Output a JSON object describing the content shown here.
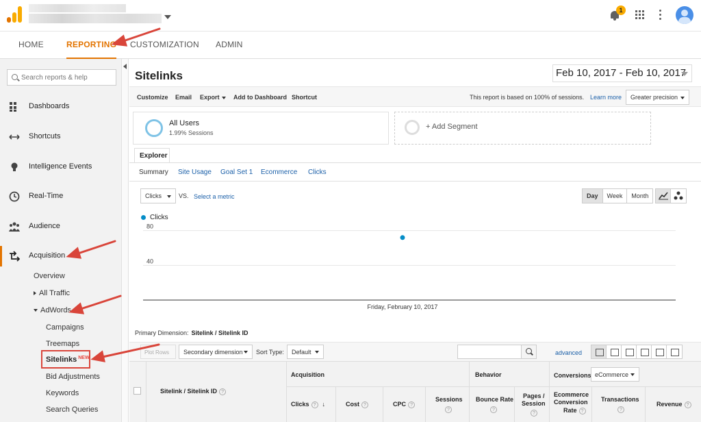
{
  "topbar": {
    "notifications_count": "1"
  },
  "nav": {
    "tabs": [
      "HOME",
      "REPORTING",
      "CUSTOMIZATION",
      "ADMIN"
    ],
    "active": "REPORTING"
  },
  "sidebar": {
    "search_placeholder": "Search reports & help",
    "items": [
      {
        "label": "Dashboards",
        "icon": "grid-icon"
      },
      {
        "label": "Shortcuts",
        "icon": "shortcut-arrows-icon"
      },
      {
        "label": "Intelligence Events",
        "icon": "lightbulb-icon"
      },
      {
        "label": "Real-Time",
        "icon": "clock-icon"
      },
      {
        "label": "Audience",
        "icon": "people-icon"
      },
      {
        "label": "Acquisition",
        "icon": "acquisition-arrows-icon"
      }
    ],
    "acquisition_children": {
      "overview": "Overview",
      "all_traffic": "All Traffic",
      "adwords": "AdWords",
      "adwords_children": [
        "Campaigns",
        "Treemaps",
        "Sitelinks",
        "Bid Adjustments",
        "Keywords",
        "Search Queries"
      ],
      "new_badge": "NEW"
    }
  },
  "report": {
    "title": "Sitelinks",
    "date_range": "Feb 10, 2017 - Feb 10, 2017",
    "toolbar": {
      "customize": "Customize",
      "email": "Email",
      "export": "Export",
      "add_to_dashboard": "Add to Dashboard",
      "shortcut": "Shortcut",
      "sessions_note": "This report is based on 100% of sessions.",
      "learn_more": "Learn more",
      "precision": "Greater precision"
    },
    "segments": {
      "all_users": "All Users",
      "all_users_sub": "1.99% Sessions",
      "add_segment": "+ Add Segment"
    },
    "explorer_tab": "Explorer",
    "subtabs": [
      "Summary",
      "Site Usage",
      "Goal Set 1",
      "Ecommerce",
      "Clicks"
    ],
    "metric_select": "Clicks",
    "vs": "VS.",
    "select_metric": "Select a metric",
    "granularity": [
      "Day",
      "Week",
      "Month"
    ],
    "granularity_active": "Day",
    "primary_dimension_label": "Primary Dimension:",
    "primary_dimension_value": "Sitelink / Sitelink ID",
    "controls": {
      "plot_rows": "Plot Rows",
      "secondary_dimension": "Secondary dimension",
      "sort_type_label": "Sort Type:",
      "sort_type_value": "Default",
      "advanced": "advanced"
    },
    "table": {
      "dimension_header": "Sitelink / Sitelink ID",
      "groups": {
        "acquisition": "Acquisition",
        "behavior": "Behavior",
        "conversions": "Conversions"
      },
      "conversions_select": "eCommerce",
      "columns": {
        "clicks": "Clicks",
        "cost": "Cost",
        "cpc": "CPC",
        "sessions": "Sessions",
        "bounce_rate": "Bounce Rate",
        "pages_session_1": "Pages /",
        "pages_session_2": "Session",
        "ecr_1": "Ecommerce",
        "ecr_2": "Conversion",
        "ecr_3": "Rate",
        "transactions": "Transactions",
        "revenue": "Revenue"
      }
    }
  },
  "chart_data": {
    "type": "line",
    "series": [
      {
        "name": "Clicks",
        "x": [
          "Friday, February 10, 2017"
        ],
        "values": [
          72
        ]
      }
    ],
    "yticks": [
      80,
      40
    ],
    "ylim": [
      0,
      90
    ],
    "x_label_shown": "Friday, February 10, 2017",
    "color": "#058dc7",
    "legend": "top-left"
  }
}
